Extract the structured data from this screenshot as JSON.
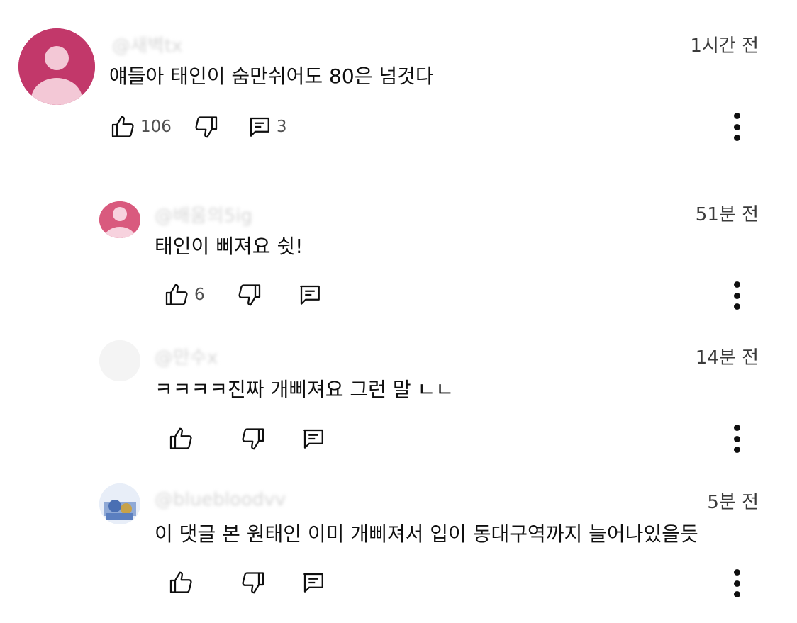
{
  "comments": [
    {
      "handle": "@새벽tx",
      "time": "1시간 전",
      "text": "얘들아 태인이 숨만쉬어도 80은 넘것다",
      "likes": "106",
      "replies": "3",
      "avatar_color": "#c2386a"
    },
    {
      "handle": "@배움의5ig",
      "time": "51분 전",
      "text": "태인이 삐져요 쉿!",
      "likes": "6",
      "replies": "",
      "avatar_color": "#d95a7e"
    },
    {
      "handle": "@만수x",
      "time": "14분 전",
      "text": "ㅋㅋㅋㅋ진짜 개삐져요 그런 말 ㄴㄴ",
      "likes": "",
      "replies": "",
      "avatar_color": "#f1f1f1"
    },
    {
      "handle": "@bluebloodvv",
      "time": "5분 전",
      "text": "이 댓글 본 원태인 이미 개삐져서 입이 동대구역까지 늘어나있을듯",
      "likes": "",
      "replies": "",
      "avatar_color": "#5b86c9"
    }
  ],
  "icons": {
    "like": "thumb-up-icon",
    "dislike": "thumb-down-icon",
    "reply": "comment-icon",
    "more": "more-vertical-icon"
  }
}
